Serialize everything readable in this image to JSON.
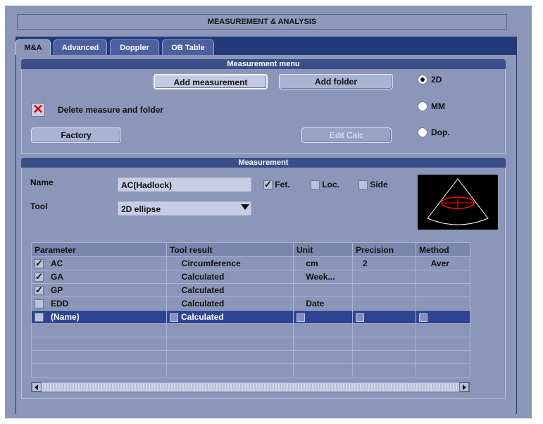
{
  "window": {
    "title": "MEASUREMENT & ANALYSIS"
  },
  "tabs": [
    {
      "label": "M&A",
      "active": true
    },
    {
      "label": "Advanced",
      "active": false
    },
    {
      "label": "Doppler",
      "active": false
    },
    {
      "label": "OB Table",
      "active": false
    }
  ],
  "measurement_menu": {
    "header": "Measurement menu",
    "add_measurement": "Add measurement",
    "add_folder": "Add folder",
    "delete_label": "Delete measure and folder",
    "factory": "Factory",
    "edit_calc": "Edit Calc",
    "modes": [
      {
        "label": "2D",
        "selected": true
      },
      {
        "label": "MM",
        "selected": false
      },
      {
        "label": "Dop.",
        "selected": false
      }
    ]
  },
  "measurement": {
    "header": "Measurement",
    "name_label": "Name",
    "name_value": "AC(Hadlock)",
    "tool_label": "Tool",
    "tool_value": "2D ellipse",
    "fet": {
      "label": "Fet.",
      "checked": true
    },
    "loc": {
      "label": "Loc.",
      "checked": false
    },
    "side": {
      "label": "Side",
      "checked": false
    }
  },
  "table": {
    "columns": [
      "Parameter",
      "Tool result",
      "Unit",
      "Precision",
      "Method"
    ],
    "rows": [
      {
        "checked": true,
        "parameter": "AC",
        "tool_result": "Circumference",
        "unit": "cm",
        "precision": "2",
        "method": "Aver"
      },
      {
        "checked": true,
        "parameter": "GA",
        "tool_result": "Calculated",
        "unit": "Week...",
        "precision": "",
        "method": ""
      },
      {
        "checked": true,
        "parameter": "GP",
        "tool_result": "Calculated",
        "unit": "",
        "precision": "",
        "method": ""
      },
      {
        "checked": false,
        "parameter": "EDD",
        "tool_result": "Calculated",
        "unit": "Date",
        "precision": "",
        "method": ""
      },
      {
        "checked": false,
        "parameter": "(Name)",
        "tool_result": "Calculated",
        "unit": "",
        "precision": "",
        "method": "",
        "selected": true
      }
    ]
  },
  "colors": {
    "panel": "#8b96b8",
    "tab_bar": "#233a7a",
    "section_header": "#3a4e8a",
    "selected_row": "#2c4491",
    "delete_x": "#d40000"
  }
}
